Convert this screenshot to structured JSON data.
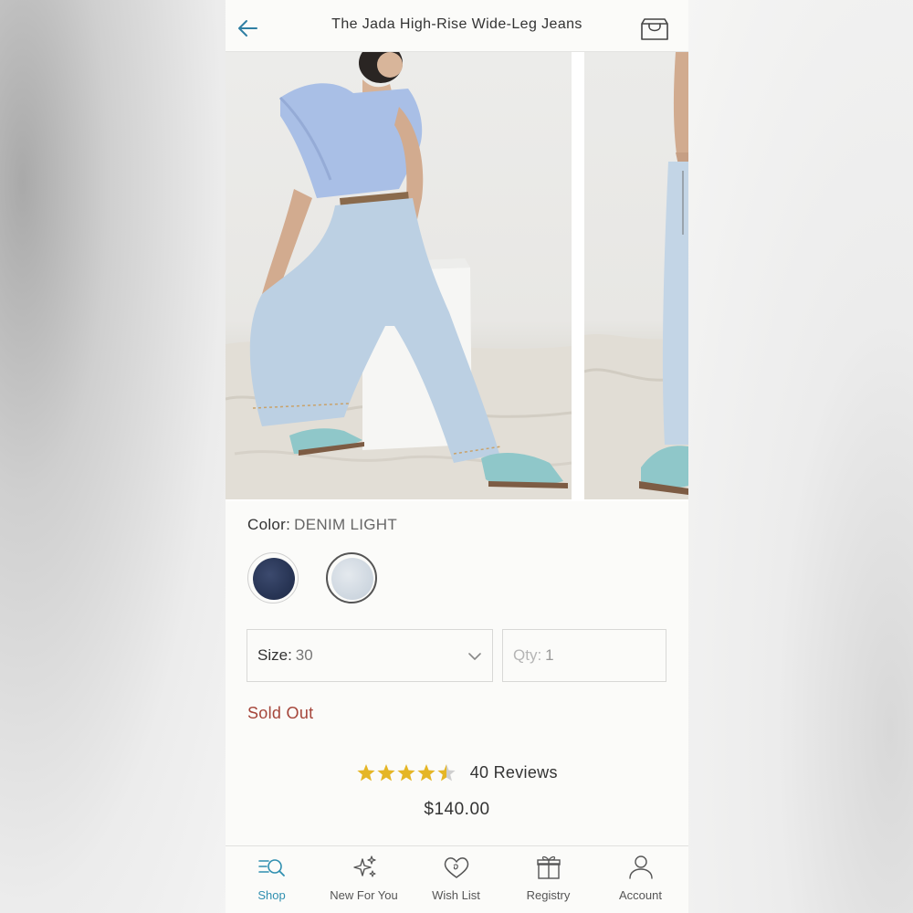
{
  "header": {
    "title": "The Jada High-Rise Wide-Leg Jeans",
    "back_icon": "arrow-left-icon",
    "bag_icon": "shopping-bag-icon"
  },
  "gallery": {
    "images": [
      {
        "name": "product-image-1"
      },
      {
        "name": "product-image-2"
      }
    ]
  },
  "product": {
    "color_label": "Color:",
    "color_value": "DENIM LIGHT",
    "swatches": [
      {
        "name": "Denim Dark",
        "color": "#2b3757",
        "selected": false
      },
      {
        "name": "Denim Light",
        "color": "#d3dbe3",
        "selected": true
      }
    ],
    "size_label": "Size:",
    "size_value": "30",
    "qty_label": "Qty:",
    "qty_value": "1",
    "status": "Sold Out",
    "rating": 4.5,
    "reviews_label": "40 Reviews",
    "price": "$140.00"
  },
  "nav": {
    "items": [
      {
        "label": "Shop",
        "icon": "shop-search-icon",
        "active": true
      },
      {
        "label": "New For You",
        "icon": "sparkles-icon",
        "active": false
      },
      {
        "label": "Wish List",
        "icon": "heart-icon",
        "active": false
      },
      {
        "label": "Registry",
        "icon": "gift-icon",
        "active": false
      },
      {
        "label": "Account",
        "icon": "person-icon",
        "active": false
      }
    ]
  },
  "colors": {
    "accent": "#2f8fb0",
    "sold_out": "#a5453a",
    "star": "#e5b626"
  }
}
